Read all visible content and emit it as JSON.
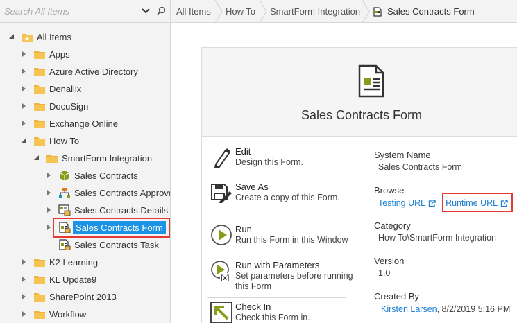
{
  "search": {
    "placeholder": "Search All Items"
  },
  "tree": [
    {
      "label": "All Items",
      "icon": "all-items-folder-icon",
      "expanded": true
    },
    {
      "label": "Apps",
      "icon": "folder-icon"
    },
    {
      "label": "Azure Active Directory",
      "icon": "folder-icon"
    },
    {
      "label": "Denallix",
      "icon": "folder-icon"
    },
    {
      "label": "DocuSign",
      "icon": "folder-icon"
    },
    {
      "label": "Exchange Online",
      "icon": "folder-icon"
    },
    {
      "label": "How To",
      "icon": "folder-icon",
      "expanded": true
    },
    {
      "label": "SmartForm Integration",
      "icon": "folder-icon",
      "expanded": true
    },
    {
      "label": "Sales Contracts",
      "icon": "smartobject-icon"
    },
    {
      "label": "Sales Contracts Approval",
      "icon": "workflow-icon"
    },
    {
      "label": "Sales Contracts Details",
      "icon": "view-icon"
    },
    {
      "label": "Sales Contracts Form",
      "icon": "form-icon",
      "selected": true
    },
    {
      "label": "Sales Contracts Task",
      "icon": "form-icon"
    },
    {
      "label": "K2 Learning",
      "icon": "folder-icon"
    },
    {
      "label": "KL Update9",
      "icon": "folder-icon"
    },
    {
      "label": "SharePoint 2013",
      "icon": "folder-icon"
    },
    {
      "label": "Workflow",
      "icon": "folder-icon"
    }
  ],
  "breadcrumb": [
    "All Items",
    "How To",
    "SmartForm Integration",
    "Sales Contracts Form"
  ],
  "card": {
    "title": "Sales Contracts Form",
    "icon": "form-document-icon",
    "actions": [
      {
        "name": "Edit",
        "desc": "Design this Form.",
        "icon": "pencil-icon"
      },
      {
        "name": "Save As",
        "desc": "Create a copy of this Form.",
        "icon": "save-as-icon"
      },
      {
        "name": "Run",
        "desc": "Run this Form in this Window",
        "icon": "run-icon"
      },
      {
        "name": "Run with Parameters",
        "desc": "Set parameters before running this Form",
        "icon": "run-with-parameters-icon"
      },
      {
        "name": "Check In",
        "desc": "Check this Form in.",
        "icon": "check-in-icon"
      }
    ],
    "properties": {
      "system_name_label": "System Name",
      "system_name": "Sales Contracts Form",
      "browse_label": "Browse",
      "testing_url": "Testing URL",
      "runtime_url": "Runtime URL",
      "category_label": "Category",
      "category": "How To\\SmartForm Integration",
      "version_label": "Version",
      "version": "1.0",
      "created_by_label": "Created By",
      "created_by": "Kirsten Larsen",
      "created_on": ", 8/2/2019 5:16 PM"
    }
  },
  "colors": {
    "accent": "#1d93e6",
    "highlight_box": "#e53935",
    "folder": "#f0b53d",
    "olive": "#8a9a1a",
    "link": "#1a7ed0"
  }
}
